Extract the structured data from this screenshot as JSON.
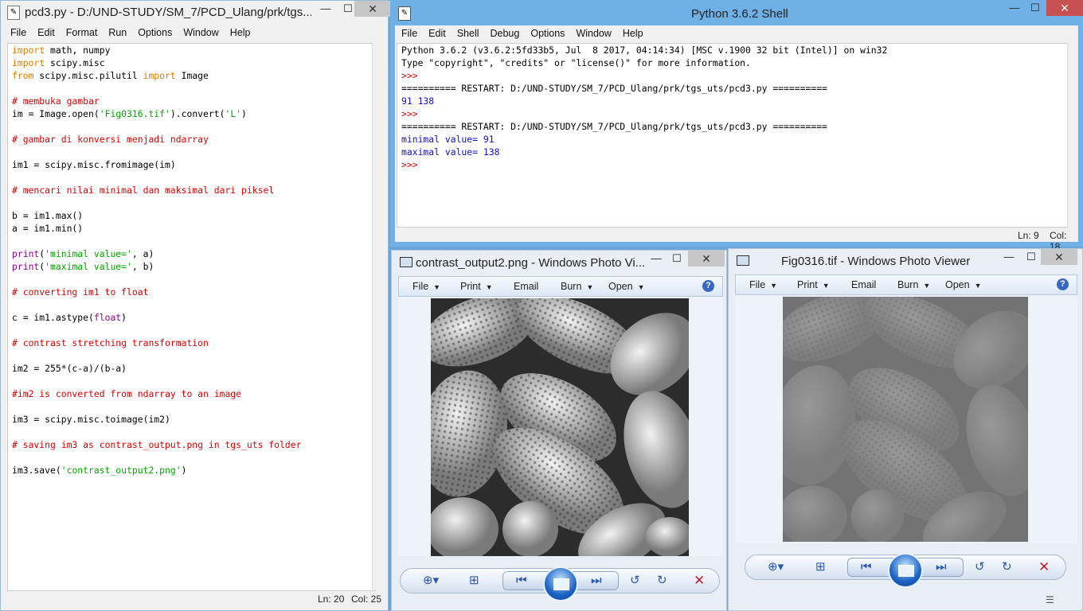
{
  "editor": {
    "title": "pcd3.py - D:/UND-STUDY/SM_7/PCD_Ulang/prk/tgs...",
    "menu": [
      "File",
      "Edit",
      "Format",
      "Run",
      "Options",
      "Window",
      "Help"
    ],
    "status_ln": "Ln: 20",
    "status_col": "Col: 25"
  },
  "code_lines": [
    [
      {
        "t": "import",
        "c": "kw"
      },
      {
        "t": " math, numpy",
        "c": ""
      }
    ],
    [
      {
        "t": "import",
        "c": "kw"
      },
      {
        "t": " scipy.misc",
        "c": ""
      }
    ],
    [
      {
        "t": "from",
        "c": "kw"
      },
      {
        "t": " scipy.misc.pilutil ",
        "c": ""
      },
      {
        "t": "import",
        "c": "kw"
      },
      {
        "t": " Image",
        "c": ""
      }
    ],
    [],
    [
      {
        "t": "# membuka gambar",
        "c": "cm"
      }
    ],
    [
      {
        "t": "im = Image.open(",
        "c": ""
      },
      {
        "t": "'Fig0316.tif'",
        "c": "str"
      },
      {
        "t": ").convert(",
        "c": ""
      },
      {
        "t": "'L'",
        "c": "str"
      },
      {
        "t": ")",
        "c": ""
      }
    ],
    [],
    [
      {
        "t": "# gambar di konversi menjadi ndarray",
        "c": "cm"
      }
    ],
    [],
    [
      {
        "t": "im1 = scipy.misc.fromimage(im)",
        "c": ""
      }
    ],
    [],
    [
      {
        "t": "# mencari nilai minimal dan maksimal dari piksel",
        "c": "cm"
      }
    ],
    [],
    [
      {
        "t": "b = im1.max()",
        "c": ""
      }
    ],
    [
      {
        "t": "a = im1.min()",
        "c": ""
      }
    ],
    [],
    [
      {
        "t": "print",
        "c": "bi"
      },
      {
        "t": "(",
        "c": ""
      },
      {
        "t": "'minimal value='",
        "c": "str"
      },
      {
        "t": ", a)",
        "c": ""
      }
    ],
    [
      {
        "t": "print",
        "c": "bi"
      },
      {
        "t": "(",
        "c": ""
      },
      {
        "t": "'maximal value='",
        "c": "str"
      },
      {
        "t": ", b)",
        "c": ""
      }
    ],
    [],
    [
      {
        "t": "# converting im1 to float",
        "c": "cm"
      }
    ],
    [],
    [
      {
        "t": "c = im1.astype(",
        "c": ""
      },
      {
        "t": "float",
        "c": "bi"
      },
      {
        "t": ")",
        "c": ""
      }
    ],
    [],
    [
      {
        "t": "# contrast stretching transformation",
        "c": "cm"
      }
    ],
    [],
    [
      {
        "t": "im2 = 255*(c-a)/(b-a)",
        "c": ""
      }
    ],
    [],
    [
      {
        "t": "#im2 is converted from ndarray to an image",
        "c": "cm"
      }
    ],
    [],
    [
      {
        "t": "im3 = scipy.misc.toimage(im2)",
        "c": ""
      }
    ],
    [],
    [
      {
        "t": "# saving im3 as contrast_output.png in tgs_uts folder",
        "c": "cm"
      }
    ],
    [],
    [
      {
        "t": "im3.save(",
        "c": ""
      },
      {
        "t": "'contrast_output2.png'",
        "c": "str"
      },
      {
        "t": ")",
        "c": ""
      }
    ]
  ],
  "shell": {
    "title": "Python 3.6.2 Shell",
    "menu": [
      "File",
      "Edit",
      "Shell",
      "Debug",
      "Options",
      "Window",
      "Help"
    ],
    "status_ln": "Ln: 9",
    "status_col": "Col: 18",
    "lines": [
      [
        {
          "t": "Python 3.6.2 (v3.6.2:5fd33b5, Jul  8 2017, 04:14:34) [MSC v.1900 32 bit (Intel)] on win32",
          "c": ""
        }
      ],
      [
        {
          "t": "Type \"copyright\", \"credits\" or \"license()\" for more information.",
          "c": ""
        }
      ],
      [
        {
          "t": ">>>",
          "c": "cm"
        }
      ],
      [
        {
          "t": "========== RESTART: D:/UND-STUDY/SM_7/PCD_Ulang/prk/tgs_uts/pcd3.py ==========",
          "c": ""
        }
      ],
      [
        {
          "t": "91 138",
          "c": "out"
        }
      ],
      [
        {
          "t": ">>>",
          "c": "cm"
        }
      ],
      [
        {
          "t": "========== RESTART: D:/UND-STUDY/SM_7/PCD_Ulang/prk/tgs_uts/pcd3.py ==========",
          "c": ""
        }
      ],
      [
        {
          "t": "minimal value= 91",
          "c": "out"
        }
      ],
      [
        {
          "t": "maximal value= 138",
          "c": "out"
        }
      ],
      [
        {
          "t": ">>>",
          "c": "cm"
        }
      ]
    ]
  },
  "viewer1": {
    "title": "contrast_output2.png - Windows Photo Vi...",
    "toolbar": {
      "file": "File",
      "print": "Print",
      "email": "Email",
      "burn": "Burn",
      "open": "Open"
    },
    "help": "?"
  },
  "viewer2": {
    "title": "Fig0316.tif - Windows Photo Viewer",
    "toolbar": {
      "file": "File",
      "print": "Print",
      "email": "Email",
      "burn": "Burn",
      "open": "Open"
    },
    "help": "?"
  },
  "captions": {
    "min": "—",
    "max": "☐",
    "close": "✕"
  }
}
